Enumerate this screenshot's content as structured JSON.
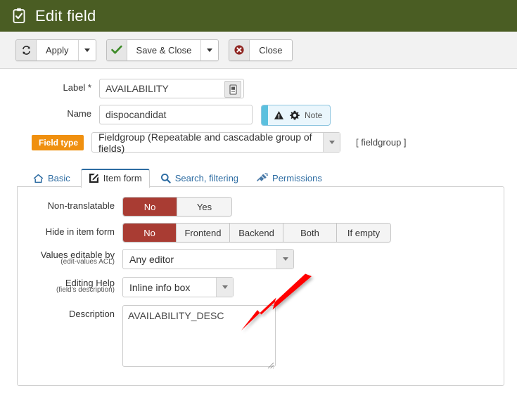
{
  "header": {
    "title": "Edit field",
    "icon": "clipboard-check-icon",
    "bg_color": "#4a5d23"
  },
  "toolbar": {
    "buttons": [
      {
        "label": "Apply",
        "icon": "refresh-icon",
        "has_caret": true
      },
      {
        "label": "Save & Close",
        "icon": "check-icon",
        "has_caret": true
      },
      {
        "label": "Close",
        "icon": "cancel-circle-icon",
        "has_caret": false
      }
    ]
  },
  "form": {
    "label_field": {
      "label": "Label *",
      "value": "AVAILABILITY",
      "placeholder": "",
      "button_icon": "translate-icon"
    },
    "name_field": {
      "label": "Name",
      "value": "dispocandidat",
      "placeholder": ""
    },
    "note_button": {
      "label": "Note",
      "warning_icon": "warning-triangle-icon",
      "gear_icon": "gear-icon",
      "accent_color": "#5bc0de"
    },
    "field_type": {
      "badge": "Field type",
      "badge_color": "#f0900f",
      "value": "Fieldgroup (Repeatable and cascadable group of fields)",
      "code": "[ fieldgroup ]"
    }
  },
  "tabs": [
    {
      "label": "Basic",
      "icon": "home-icon",
      "active": false
    },
    {
      "label": "Item form",
      "icon": "edit-square-icon",
      "active": true
    },
    {
      "label": "Search, filtering",
      "icon": "search-icon",
      "active": false
    },
    {
      "label": "Permissions",
      "icon": "plug-icon",
      "active": false
    }
  ],
  "item_form": {
    "non_translatable": {
      "label": "Non-translatable",
      "options": [
        "No",
        "Yes"
      ],
      "selected": "No"
    },
    "hide_in_item_form": {
      "label": "Hide in item form",
      "options": [
        "No",
        "Frontend",
        "Backend",
        "Both",
        "If empty"
      ],
      "selected": "No"
    },
    "values_editable_by": {
      "label": "Values editable by",
      "sublabel": "(edit-values ACL)",
      "value": "Any editor"
    },
    "editing_help": {
      "label": "Editing Help",
      "sublabel": "(field's description)",
      "value": "Inline info box"
    },
    "description": {
      "label": "Description",
      "value": "AVAILABILITY_DESC",
      "placeholder": ""
    }
  },
  "annotation": {
    "type": "arrow",
    "color": "#ff0000",
    "points_to": "description-textarea"
  },
  "colors": {
    "selected_red": "#a93c33",
    "link_blue": "#2d6ca2",
    "header_green": "#4a5d23"
  }
}
